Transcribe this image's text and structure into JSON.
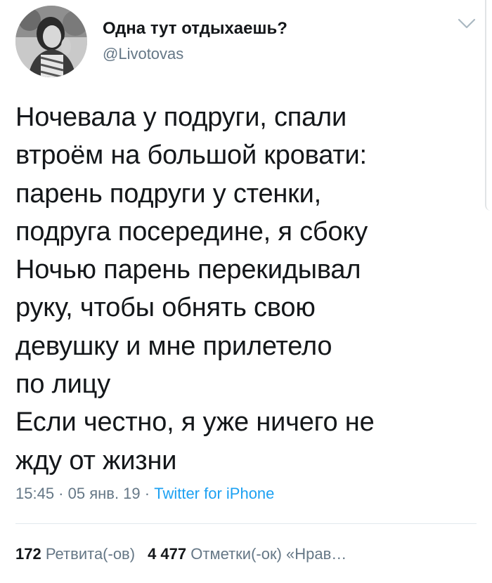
{
  "author": {
    "display_name": "Одна тут отдыхаешь?",
    "handle": "@Livotovas"
  },
  "tweet": {
    "lines": [
      "Ночевала у подруги, спали",
      "втроём на большой кровати:",
      "парень подруги у стенки,",
      "подруга посередине, я сбоку",
      "Ночью парень перекидывал",
      "руку, чтобы обнять свою",
      "девушку и мне прилетело",
      "по лицу",
      "Если честно, я уже ничего не",
      "жду от жизни"
    ]
  },
  "meta": {
    "time": "15:45",
    "separator": " · ",
    "date": "05 янв. 19",
    "source": "Twitter for iPhone"
  },
  "stats": {
    "retweets_count": "172",
    "retweets_label": "Ретвита(-ов)",
    "likes_count": "4 477",
    "likes_label": "Отметки(-ок) «Нрав…"
  },
  "icons": {
    "menu": "chevron-down-icon",
    "avatar": "avatar"
  }
}
